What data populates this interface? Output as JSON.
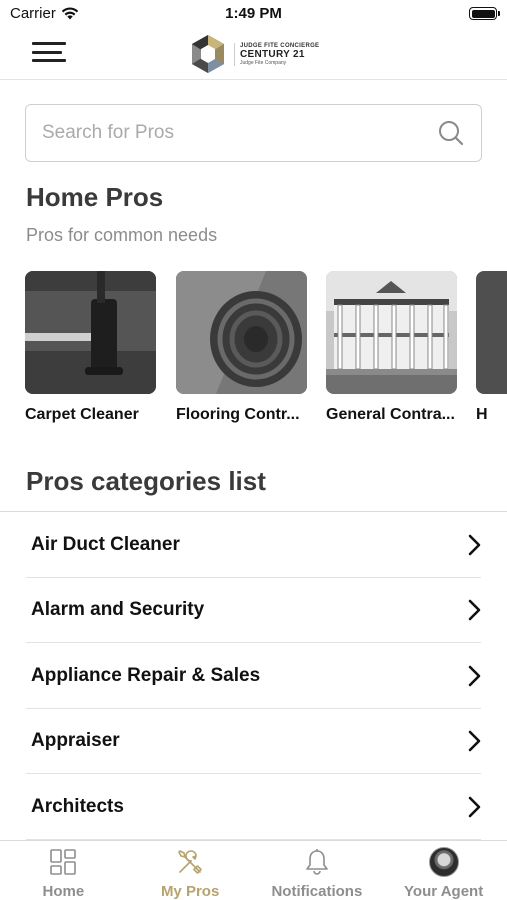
{
  "status_bar": {
    "carrier": "Carrier",
    "time": "1:49 PM"
  },
  "header": {
    "logo": {
      "line1": "JUDGE FITE CONCIERGE",
      "line2": "CENTURY 21",
      "line3": "Judge Fite Company"
    }
  },
  "search": {
    "placeholder": "Search for Pros"
  },
  "home_pros": {
    "title": "Home Pros",
    "subtitle": "Pros for common needs",
    "cards": [
      {
        "label": "Carpet Cleaner",
        "image": "carpet-cleaner-photo"
      },
      {
        "label": "Flooring Contr...",
        "image": "flooring-roll-photo"
      },
      {
        "label": "General Contra...",
        "image": "house-photo"
      },
      {
        "label": "H",
        "image": "partial-photo"
      }
    ]
  },
  "categories": {
    "title": "Pros categories list",
    "items": [
      {
        "label": "Air Duct Cleaner"
      },
      {
        "label": "Alarm and Security"
      },
      {
        "label": "Appliance Repair & Sales"
      },
      {
        "label": "Appraiser"
      },
      {
        "label": "Architects"
      }
    ]
  },
  "tab_bar": {
    "tabs": [
      {
        "label": "Home",
        "icon": "grid-icon",
        "active": false
      },
      {
        "label": "My Pros",
        "icon": "tools-icon",
        "active": true
      },
      {
        "label": "Notifications",
        "icon": "bell-icon",
        "active": false
      },
      {
        "label": "Your Agent",
        "icon": "avatar",
        "active": false
      }
    ]
  },
  "colors": {
    "accent": "#b6a36e",
    "inactive_tab": "#8e8e8e",
    "heading": "#3a3a3a",
    "subtitle": "#8c8c8c"
  }
}
